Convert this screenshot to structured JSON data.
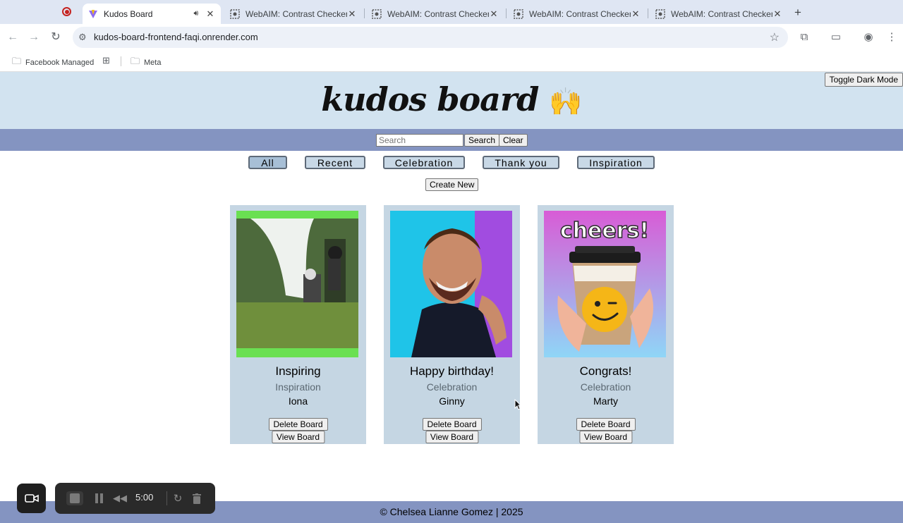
{
  "browser": {
    "tabs": [
      {
        "title": "Kudos Board",
        "active": true,
        "icon": "vite-logo-icon"
      },
      {
        "title": "WebAIM: Contrast Checker",
        "active": false,
        "icon": "webaim-icon"
      },
      {
        "title": "WebAIM: Contrast Checker",
        "active": false,
        "icon": "webaim-icon"
      },
      {
        "title": "WebAIM: Contrast Checker",
        "active": false,
        "icon": "webaim-icon"
      },
      {
        "title": "WebAIM: Contrast Checker",
        "active": false,
        "icon": "webaim-icon"
      }
    ],
    "url": "kudos-board-frontend-faqi.onrender.com",
    "bookmarks": [
      {
        "label": "Facebook Managed",
        "icon": "managed-folder-icon"
      },
      {
        "label": "",
        "icon": "apps-grid-icon"
      },
      {
        "label": "Meta",
        "icon": "folder-icon"
      }
    ]
  },
  "header": {
    "toggle_label": "Toggle Dark Mode",
    "brand": "kudos board",
    "brand_emoji": "🙌"
  },
  "search": {
    "placeholder": "Search",
    "search_label": "Search",
    "clear_label": "Clear"
  },
  "filters": [
    {
      "label": "All",
      "selected": true
    },
    {
      "label": "Recent",
      "selected": false
    },
    {
      "label": "Celebration",
      "selected": false
    },
    {
      "label": "Thank you",
      "selected": false
    },
    {
      "label": "Inspiration",
      "selected": false
    }
  ],
  "create_label": "Create New",
  "boards": [
    {
      "title": "Inspiring",
      "category": "Inspiration",
      "author": "Iona",
      "delete_label": "Delete Board",
      "view_label": "View Board"
    },
    {
      "title": "Happy birthday!",
      "category": "Celebration",
      "author": "Ginny",
      "delete_label": "Delete Board",
      "view_label": "View Board"
    },
    {
      "title": "Congrats!",
      "category": "Celebration",
      "author": "Marty",
      "delete_label": "Delete Board",
      "view_label": "View Board"
    }
  ],
  "board_images": {
    "cheers_text": "cheers!"
  },
  "footer": {
    "text": "© Chelsea Lianne Gomez | 2025"
  },
  "recorder": {
    "time": "5:00"
  },
  "colors": {
    "header_bg": "#d2e3f0",
    "bar_bg": "#8494c1",
    "card_bg": "#c5d6e3",
    "filter_bg": "#c8d8e6"
  }
}
